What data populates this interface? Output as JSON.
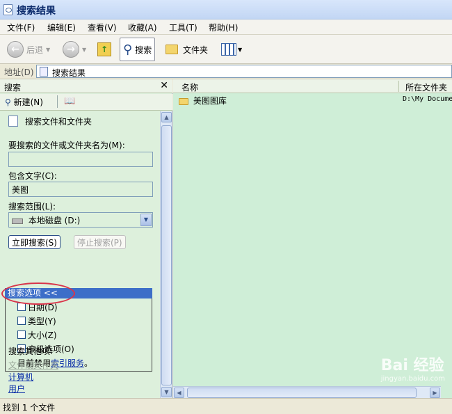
{
  "window": {
    "title": "搜索结果"
  },
  "menu": [
    "文件(F)",
    "编辑(E)",
    "查看(V)",
    "收藏(A)",
    "工具(T)",
    "帮助(H)"
  ],
  "toolbar": {
    "back": "后退",
    "search": "搜索",
    "folders": "文件夹"
  },
  "address": {
    "label": "地址(D)",
    "value": "搜索结果"
  },
  "search_pane": {
    "title": "搜索",
    "new_label": "新建(N)",
    "heading": "搜索文件和文件夹",
    "name_label": "要搜索的文件或文件夹名为(M):",
    "name_value": "",
    "contain_label": "包含文字(C):",
    "contain_value": "美图",
    "scope_label": "搜索范围(L):",
    "scope_value": "本地磁盘 (D:)",
    "search_now": "立即搜索(S)",
    "stop_search": "停止搜索(P)",
    "options_header": "搜索选项 <<",
    "options": [
      "日期(D)",
      "类型(Y)",
      "大小(Z)",
      "高级选项(O)"
    ],
    "index_prefix": "目前禁用",
    "index_link": "索引服务",
    "index_suffix": "。",
    "other_heading": "搜索其他项:",
    "other_items": [
      "文件或文件夹",
      "计算机",
      "用户"
    ]
  },
  "results": {
    "columns": [
      "名称",
      "所在文件夹"
    ],
    "rows": [
      {
        "name": "美图图库",
        "folder": "D:\\My Docume"
      }
    ]
  },
  "status": "找到 1 个文件",
  "watermark": {
    "brand": "Bai 经验",
    "url": "jingyan.baidu.com"
  }
}
